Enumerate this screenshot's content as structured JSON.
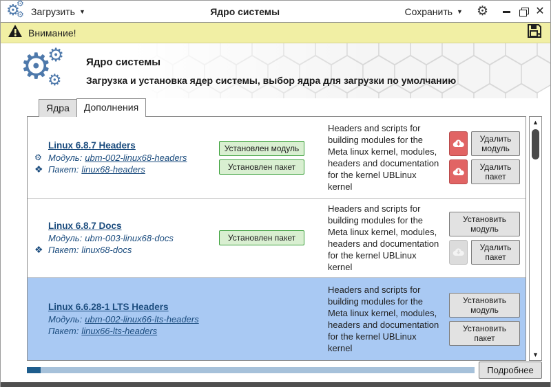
{
  "titlebar": {
    "load_menu": "Загрузить",
    "title": "Ядро системы",
    "save_menu": "Сохранить"
  },
  "warning_bar": {
    "label": "Внимание!"
  },
  "header": {
    "title": "Ядро системы",
    "subtitle": "Загрузка и установка ядер системы, выбор ядра для загрузки по умолчанию"
  },
  "tabs": {
    "kernels": "Ядра",
    "addons": "Дополнения"
  },
  "rows": [
    {
      "title": "Linux 6.8.7 Headers",
      "module_label": "Модуль:",
      "module": "ubm-002-linux68-headers",
      "package_label": "Пакет:",
      "package": "linux68-headers",
      "badge_module": "Установлен модуль",
      "badge_package": "Установлен пакет",
      "description": "Headers and scripts for building modules for the Meta linux kernel, modules, headers and documentation for the kernel UBLinux kernel",
      "action_module": "Удалить модуль",
      "action_package": "Удалить пакет"
    },
    {
      "title": "Linux 6.8.7 Docs",
      "module_label": "Модуль:",
      "module": "ubm-003-linux68-docs",
      "package_label": "Пакет:",
      "package": "linux68-docs",
      "badge_package": "Установлен пакет",
      "description": "Headers and scripts for building modules for the Meta linux kernel, modules, headers and documentation for the kernel UBLinux kernel",
      "action_module": "Установить модуль",
      "action_package": "Удалить пакет"
    },
    {
      "title": "Linux 6.6.28-1 LTS Headers",
      "module_label": "Модуль:",
      "module": "ubm-002-linux66-lts-headers",
      "package_label": "Пакет:",
      "package": "linux66-lts-headers",
      "description": "Headers and scripts for building modules for the Meta linux kernel, modules, headers and documentation for the kernel UBLinux kernel",
      "action_module": "Установить модуль",
      "action_package": "Установить пакет"
    }
  ],
  "footer": {
    "details_button": "Подробнее",
    "progress_percent": 3
  },
  "icons": {
    "gear": "⚙",
    "caret_down": "▼",
    "close": "✕",
    "package": "❖",
    "scroll_up": "▲",
    "scroll_down": "▼"
  },
  "colors": {
    "accent_blue": "#4e79ab",
    "link_navy": "#1b4c7e",
    "selected_row": "#a9c9f3",
    "warning_bg": "#f1efa4",
    "badge_green_border": "#3aa03a",
    "badge_green_bg": "#d9efd1",
    "danger_red": "#e16464",
    "progress_fill": "#1e5d8d",
    "progress_track": "#a6c1da"
  }
}
